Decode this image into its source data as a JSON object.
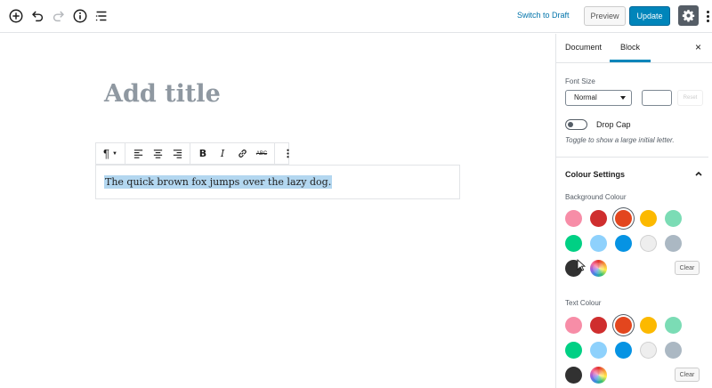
{
  "topbar": {
    "icons": [
      "add-block-icon",
      "undo-icon",
      "redo-icon",
      "info-icon",
      "outline-icon"
    ],
    "switch_to_draft": "Switch to Draft",
    "preview_label": "Preview",
    "update_label": "Update"
  },
  "editor": {
    "title_placeholder": "Add title",
    "paragraph_text": "The quick brown fox jumps over the lazy dog.",
    "toolbar": {
      "paragraph_icon": "¶",
      "bold": "B",
      "italic": "I",
      "strikethrough": "ABC"
    }
  },
  "sidebar": {
    "tabs": [
      "Document",
      "Block"
    ],
    "active_tab": "Block",
    "close_icon": "×",
    "font_size_label": "Font Size",
    "font_size_value": "Normal",
    "reset_label": "Reset",
    "drop_cap_label": "Drop Cap",
    "drop_cap_help": "Toggle to show a large initial letter.",
    "colour_settings_title": "Colour Settings",
    "background_colour_label": "Background Colour",
    "text_colour_label": "Text Colour",
    "clear_label": "Clear",
    "palette": [
      "#f78da7",
      "#cf2e2e",
      "#e3461e",
      "#fcb900",
      "#7bdcb5",
      "#00d084",
      "#8ed1fc",
      "#0693e3",
      "#eeeeee",
      "#abb8c3",
      "#313131"
    ],
    "selected_swatch_index": 2
  }
}
